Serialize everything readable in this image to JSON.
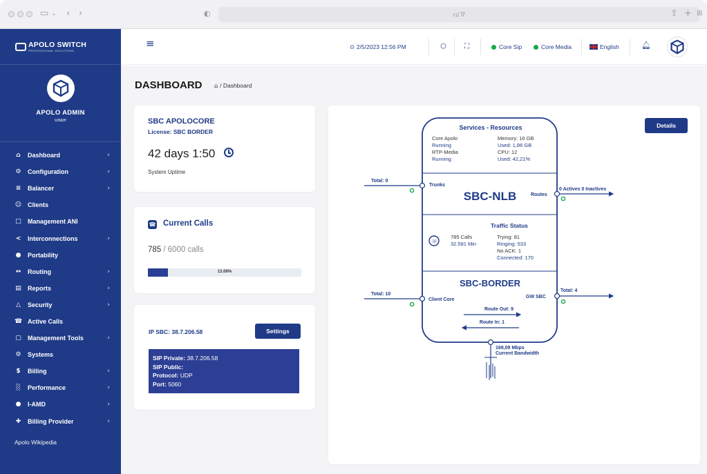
{
  "browser": {
    "address": "เป ∇"
  },
  "sidebar": {
    "brand": "APOLO SWITCH",
    "brand_sub": "PROFESSIONAL SOLUTIONS",
    "profile_name": "APOLO ADMIN",
    "profile_role": "USER",
    "items": [
      {
        "label": "Dashboard",
        "icon": "home-icon",
        "glyph": "⌂",
        "chevron": true
      },
      {
        "label": "Configuration",
        "icon": "gear-icon",
        "glyph": "⚙",
        "chevron": true
      },
      {
        "label": "Balancer",
        "icon": "sliders-icon",
        "glyph": "≡",
        "chevron": true
      },
      {
        "label": "Clients",
        "icon": "users-icon",
        "glyph": "☺",
        "chevron": false
      },
      {
        "label": "Management ANI",
        "icon": "id-card-icon",
        "glyph": "□",
        "chevron": false
      },
      {
        "label": "Interconnections",
        "icon": "share-icon",
        "glyph": "<",
        "chevron": true
      },
      {
        "label": "Portability",
        "icon": "sync-icon",
        "glyph": "●",
        "chevron": false
      },
      {
        "label": "Routing",
        "icon": "route-icon",
        "glyph": "↔",
        "chevron": true
      },
      {
        "label": "Reports",
        "icon": "file-icon",
        "glyph": "▤",
        "chevron": true
      },
      {
        "label": "Security",
        "icon": "lock-icon",
        "glyph": "△",
        "chevron": true
      },
      {
        "label": "Active Calls",
        "icon": "phone-icon",
        "glyph": "☎",
        "chevron": false
      },
      {
        "label": "Management Tools",
        "icon": "monitor-icon",
        "glyph": "▢",
        "chevron": true
      },
      {
        "label": "Systems",
        "icon": "cog-icon",
        "glyph": "⚙",
        "chevron": false
      },
      {
        "label": "Billing",
        "icon": "dollar-icon",
        "glyph": "$",
        "chevron": true
      },
      {
        "label": "Performance",
        "icon": "bar-chart-icon",
        "glyph": "░",
        "chevron": true
      },
      {
        "label": "I-AMD",
        "icon": "circle-icon",
        "glyph": "●",
        "chevron": true
      },
      {
        "label": "Billing Provider",
        "icon": "plus-icon",
        "glyph": "✚",
        "chevron": true
      }
    ],
    "wiki_link": "Apolo Wikipedia"
  },
  "topbar": {
    "datetime": "2/5/2023 12:56 PM",
    "core_sip": "Core Sip",
    "core_media": "Core Media",
    "language": "English",
    "status_color": "#19a84a"
  },
  "page": {
    "title": "DASHBOARD",
    "breadcrumb": "/ Dashboard"
  },
  "sbc_card": {
    "title": "SBC APOLOCORE",
    "license": "License: SBC BORDER",
    "uptime": "42 days 1:50",
    "uptime_label": "System Uptime"
  },
  "calls_card": {
    "title": "Current Calls",
    "current": "785",
    "total": "/ 6000 calls",
    "percent_label": "13.08%",
    "percent": 13.08
  },
  "ip_card": {
    "ip": "IP SBC: 38.7.206.58",
    "settings_label": "Settings",
    "sip_private_label": "SIP Private:",
    "sip_private": "38.7.206.58",
    "sip_public_label": "SIP Public:",
    "sip_public": "",
    "protocol_label": "Protocol:",
    "protocol": "UDP",
    "port_label": "Port:",
    "port": "5060"
  },
  "diagram": {
    "details_label": "Details",
    "services_title": "Services - Resources",
    "core_apolo": "Core Apolo",
    "core_apolo_status": "Running",
    "rtp_media": "RTP-Media",
    "rtp_media_status": "Running",
    "memory": "Memory: 16 GB",
    "memory_used": "Used: 1,86 GB",
    "cpu": "CPU: 12",
    "cpu_used": "Used: 42,21%",
    "nlb_title": "SBC-NLB",
    "trunks": "Trunks",
    "routes": "Routes",
    "total_left_top": "Total: 0",
    "actives": "0 Actives 0 Inactives",
    "traffic_title": "Traffic Status",
    "calls": "785 Calls",
    "minutes": "32.581 Min",
    "trying": "Trying: 81",
    "ringing": "Ringing: 533",
    "no_ack": "No ACK: 1",
    "connected": "Connected: 170",
    "border_title": "SBC-BORDER",
    "client_core": "Client Core",
    "gw_sbc": "GW SBC",
    "total_left_bottom": "Total: 10",
    "total_right_bottom": "Total: 4",
    "route_out": "Route Out: 9",
    "route_in": "Route In: 1",
    "bandwidth": "169,09 Mbps",
    "bandwidth_label": "Current Bandwidth",
    "accent": "#1f3b87"
  }
}
